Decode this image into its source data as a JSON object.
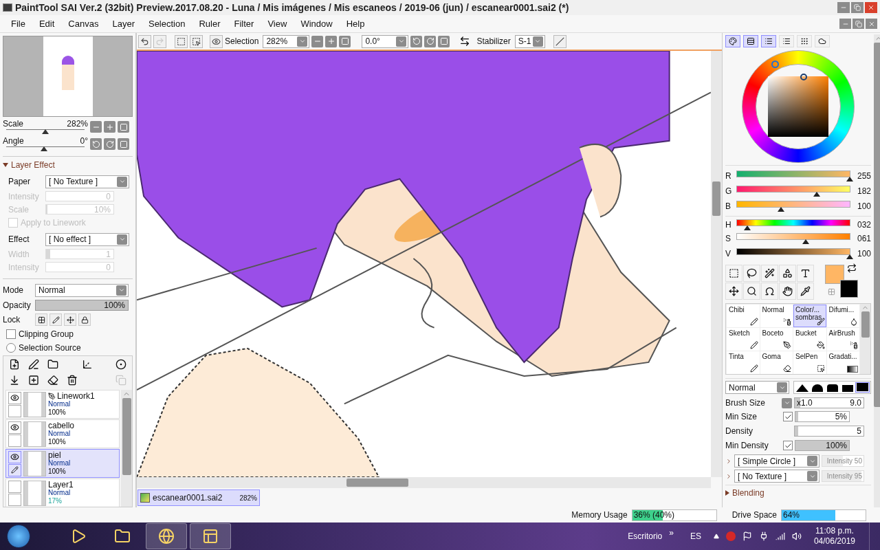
{
  "window": {
    "title": "PaintTool SAI Ver.2 (32bit) Preview.2017.08.20 - Luna / Mis imágenes / Mis escaneos / 2019-06 (jun) / escanear0001.sai2 (*)"
  },
  "menu": [
    "File",
    "Edit",
    "Canvas",
    "Layer",
    "Selection",
    "Ruler",
    "Filter",
    "View",
    "Window",
    "Help"
  ],
  "navigator": {
    "sliders": [
      {
        "label": "Scale",
        "value": "282%",
        "level": 0.5
      },
      {
        "label": "Angle",
        "value": "0°",
        "level": 0.48
      }
    ]
  },
  "layer_effect": {
    "title": "Layer Effect",
    "expanded": true,
    "rows": [
      {
        "kind": "dropdown",
        "label": "Paper",
        "value": "[ No Texture ]"
      },
      {
        "kind": "slider",
        "label": "Intensity",
        "value": "0",
        "disabled": true
      },
      {
        "kind": "slider",
        "label": "Scale",
        "value": "10%",
        "level": 0.02,
        "disabled": true
      },
      {
        "kind": "checkbox",
        "label": "Apply to Linework",
        "checked": false,
        "disabled": true
      },
      {
        "kind": "dropdown",
        "label": "Effect",
        "value": "[ No effect ]"
      },
      {
        "kind": "slider",
        "label": "Width",
        "value": "1",
        "level": 0.06,
        "disabled": true
      },
      {
        "kind": "slider",
        "label": "Intensity",
        "value": "0",
        "disabled": true
      }
    ]
  },
  "layer_props": {
    "mode": {
      "label": "Mode",
      "value": "Normal"
    },
    "opacity": {
      "label": "Opacity",
      "value": "100%",
      "level": 1
    },
    "lock": {
      "label": "Lock"
    },
    "clipping": {
      "label": "Clipping Group",
      "checked": false
    },
    "selection_source": {
      "label": "Selection Source",
      "selected": false
    }
  },
  "layers": [
    {
      "name": "Linework1",
      "kind": "linework",
      "mode": "Normal",
      "opacity": "100%",
      "partial": false,
      "visible": true,
      "selected": false
    },
    {
      "name": "cabello",
      "kind": "raster",
      "mode": "Normal",
      "opacity": "100%",
      "partial": false,
      "visible": true,
      "selected": false
    },
    {
      "name": "piel",
      "kind": "raster",
      "mode": "Normal",
      "opacity": "100%",
      "partial": false,
      "visible": true,
      "selected": true
    },
    {
      "name": "Layer1",
      "kind": "raster",
      "mode": "Normal",
      "opacity": "17%",
      "partial": true,
      "visible": false,
      "selected": false
    }
  ],
  "toolbar": {
    "redo_disabled": true,
    "selection_label": "Selection",
    "zoom": "282%",
    "angle": "0.0°",
    "stabilizer_label": "Stabilizer",
    "stabilizer": "S-1"
  },
  "doc_tabs": [
    {
      "name": "escanear0001.sai2",
      "zoom": "282%",
      "selected": true
    }
  ],
  "color_panel": {
    "modes": [
      {
        "kind": "wheel",
        "selected": true
      },
      {
        "kind": "rgb",
        "selected": true
      },
      {
        "kind": "hsv",
        "selected": true
      },
      {
        "kind": "swatches",
        "selected": false
      },
      {
        "kind": "scratch",
        "selected": false
      },
      {
        "kind": "pad",
        "selected": false
      }
    ],
    "sliders": [
      {
        "kind": "r",
        "label": "R",
        "value": "255",
        "level": 1
      },
      {
        "kind": "g",
        "label": "G",
        "value": "182",
        "level": 0.71
      },
      {
        "kind": "b",
        "label": "B",
        "value": "100",
        "level": 0.39
      },
      {
        "kind": "h",
        "label": "H",
        "value": "032",
        "level": 0.09
      },
      {
        "kind": "s",
        "label": "S",
        "value": "061",
        "level": 0.61
      },
      {
        "kind": "v",
        "label": "V",
        "value": "100",
        "level": 1
      }
    ]
  },
  "brushes": [
    {
      "name": "Chibi",
      "kind": "pencil",
      "selected": false
    },
    {
      "name": "Normal",
      "kind": "airbrush",
      "selected": false
    },
    {
      "name": "Color/...",
      "subname": "sombras",
      "kind": "brush",
      "selected": true
    },
    {
      "name": "Difumi...",
      "kind": "blur",
      "selected": false
    },
    {
      "name": "Sketch",
      "kind": "pencil",
      "selected": false
    },
    {
      "name": "Boceto",
      "kind": "pen",
      "selected": false
    },
    {
      "name": "Bucket",
      "kind": "bucket",
      "selected": false
    },
    {
      "name": "AirBrush",
      "kind": "airbrush",
      "selected": false
    },
    {
      "name": "Tinta",
      "kind": "pencil",
      "selected": false
    },
    {
      "name": "Goma",
      "kind": "eraser",
      "selected": false
    },
    {
      "name": "SelPen",
      "kind": "selpen",
      "selected": false
    },
    {
      "name": "Gradati...",
      "kind": "gradient",
      "selected": false
    }
  ],
  "brush_settings": {
    "blend": "Normal",
    "shapes": [
      {
        "kind": "cone",
        "selected": false
      },
      {
        "kind": "dome",
        "selected": false
      },
      {
        "kind": "flat",
        "selected": false
      },
      {
        "kind": "block",
        "selected": false
      },
      {
        "kind": "full",
        "selected": true
      }
    ],
    "rows": [
      {
        "kind": "size",
        "label": "Brush Size",
        "multiplier": "x1.0",
        "value": "9.0",
        "level": 0.08
      },
      {
        "kind": "check",
        "label": "Min Size",
        "checked": true,
        "value": "5%",
        "level": 0.05
      },
      {
        "kind": "plain",
        "label": "Density",
        "value": "5",
        "level": 0.05
      },
      {
        "kind": "check",
        "label": "Min Density",
        "checked": true,
        "value": "100%",
        "level": 1
      }
    ],
    "textures": [
      {
        "value": "[ Simple Circle ]",
        "intensity": "Intensity 50",
        "level": 0.5
      },
      {
        "value": "[ No Texture ]",
        "intensity": "Intensity 95",
        "level": 0.95
      }
    ],
    "blending": {
      "label": "Blending",
      "expanded": false
    }
  },
  "status": {
    "memory": {
      "label": "Memory Usage",
      "value": "36% (40%)",
      "level": 0.36
    },
    "drive": {
      "label": "Drive Space",
      "value": "64%",
      "level": 0.64
    }
  },
  "taskbar": {
    "apps": [
      {
        "kind": "media",
        "running": false
      },
      {
        "kind": "folder",
        "running": false
      },
      {
        "kind": "browser",
        "running": true
      },
      {
        "kind": "paint",
        "running": true
      }
    ],
    "desktop": "Escritorio",
    "chevron": "»",
    "language": "ES",
    "time": "11:08 p.m.",
    "date": "04/06/2019"
  }
}
